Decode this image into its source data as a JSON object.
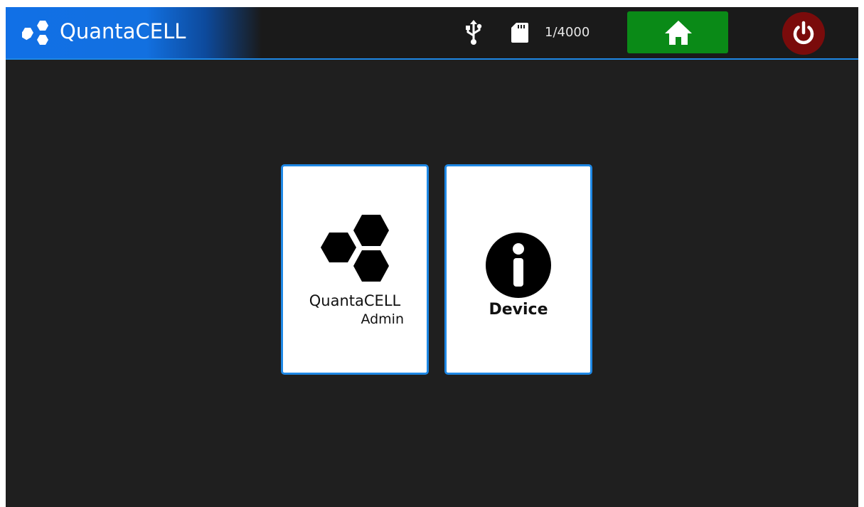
{
  "header": {
    "app_title": "QuantaCELL",
    "logo_icon": "hexagon-cluster-logo",
    "usb_icon": "usb-icon",
    "sd_icon": "sd-card-icon",
    "sd_count": "1/4000",
    "home_icon": "home-icon",
    "power_icon": "power-icon"
  },
  "colors": {
    "accent": "#1e88e5",
    "home_button": "#0a8a17",
    "power_button": "#7a0b0b",
    "background": "#1f1f1f"
  },
  "tiles": [
    {
      "label": "QuantaCELL",
      "sublabel": "Admin",
      "icon": "hexagon-cluster-icon"
    },
    {
      "label": "Device",
      "icon": "info-icon"
    }
  ]
}
